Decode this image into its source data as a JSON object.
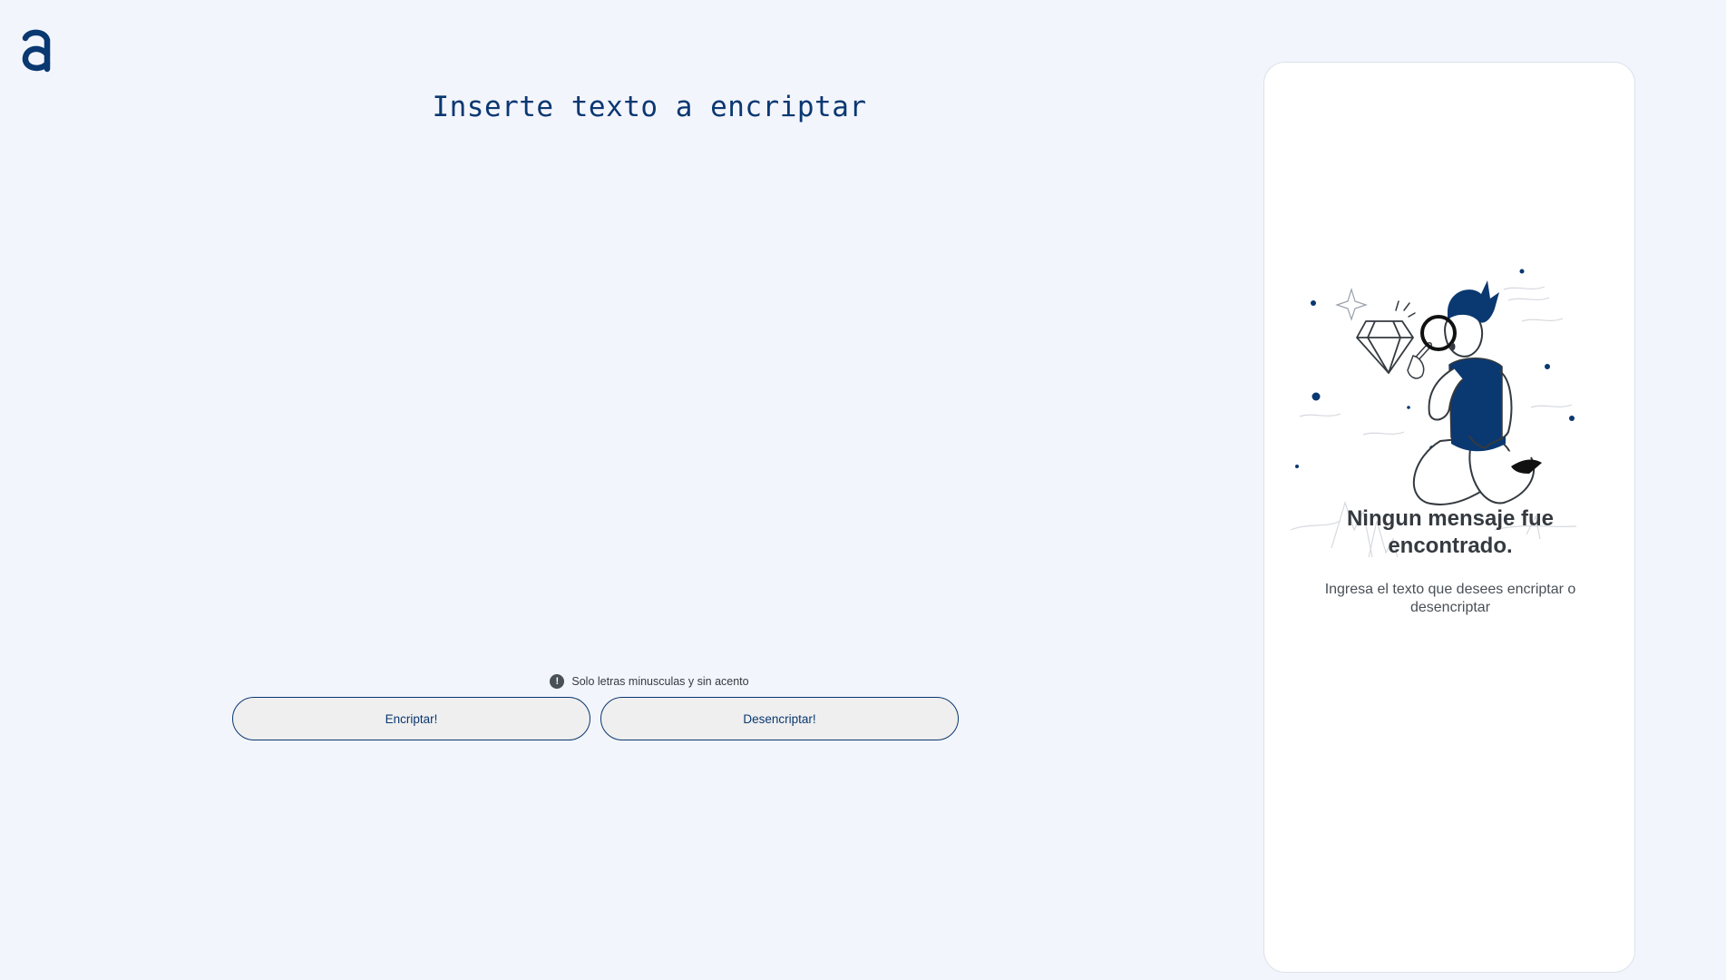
{
  "logo": {
    "icon": "alura-logo-icon",
    "color": "#0a3871"
  },
  "input": {
    "placeholder": "Inserte texto a encriptar",
    "value": ""
  },
  "hint": {
    "icon": "exclamation-circle-icon",
    "text": "Solo letras minusculas y sin acento"
  },
  "buttons": {
    "encrypt_label": "Encriptar!",
    "decrypt_label": "Desencriptar!"
  },
  "output": {
    "title": "Ningun mensaje fue encontrado.",
    "subtitle": "Ingresa el texto que desees encriptar o desencriptar",
    "illustration": "person-with-magnifying-glass-illustration"
  },
  "colors": {
    "accent": "#0a3871",
    "background": "#f3f5fc",
    "panel": "#ffffff"
  }
}
